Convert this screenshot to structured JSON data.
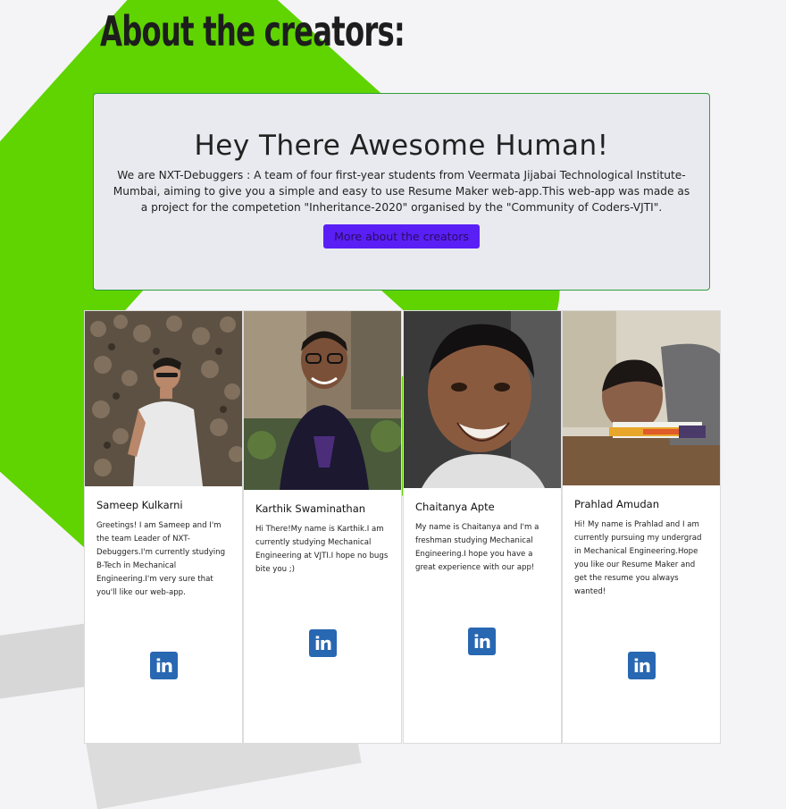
{
  "page": {
    "title": "About the creators:"
  },
  "jumbotron": {
    "heading": "Hey There Awesome Human!",
    "text": "We are NXT-Debuggers : A team of four first-year students from Veermata Jijabai Technological Institute-Mumbai, aiming to give you a simple and easy to use Resume Maker web-app.This web-app was made as a project for the competetion \"Inheritance-2020\" organised by the \"Community of Coders-VJTI\".",
    "button_label": "More about the creators"
  },
  "creators": [
    {
      "name": "Sameep Kulkarni",
      "bio": "Greetings! I am Sameep and I'm the team Leader of NXT-Debuggers.I'm currently studying B-Tech in Mechanical Engineering.I'm very sure that you'll like our web-app.",
      "social_icon": "in"
    },
    {
      "name": "Karthik Swaminathan",
      "bio": "Hi There!My name is Karthik.I am currently studying Mechanical Engineering at VJTI.I hope no bugs bite you ;)",
      "social_icon": "in"
    },
    {
      "name": "Chaitanya Apte",
      "bio": "My name is Chaitanya and I'm a freshman studying Mechanical Engineering.I hope you have a great experience with our app!",
      "social_icon": "in"
    },
    {
      "name": "Prahlad Amudan",
      "bio": "Hi! My name is Prahlad and I am currently pursuing my undergrad in Mechanical Engineering.Hope you like our Resume Maker and get the resume you always wanted!",
      "social_icon": "in"
    }
  ],
  "colors": {
    "accent_button": "#5a1ff5",
    "linkedin": "#2867b2",
    "jumbotron_border": "#2e9e3a",
    "background_shape": "#5fd400"
  }
}
